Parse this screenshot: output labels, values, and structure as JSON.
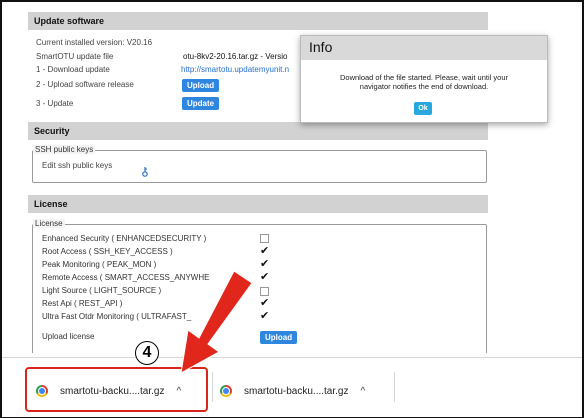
{
  "update": {
    "header": "Update software",
    "current_version": "Current installed version: V20.16",
    "file_label": "SmartOTU update file",
    "file_value": "otu-8kv2-20.16.tar.gz - Versio",
    "step1": "1 - Download update",
    "step1_link": "http://smartotu.updatemyunit.n",
    "step2": "2 - Upload software release",
    "step2_button": "Upload",
    "step3": "3 - Update",
    "step3_button": "Update"
  },
  "security": {
    "header": "Security",
    "ssh_legend": "SSH public keys",
    "ssh_edit": "Edit ssh public keys"
  },
  "license": {
    "header": "License",
    "legend": "License",
    "items": [
      {
        "label": "Enhanced Security ( ENHANCEDSECURITY )",
        "checked": false
      },
      {
        "label": "Root Access ( SSH_KEY_ACCESS )",
        "checked": true
      },
      {
        "label": "Peak Monitoring ( PEAK_MON )",
        "checked": true
      },
      {
        "label": "Remote Access ( SMART_ACCESS_ANYWHE",
        "checked": true
      },
      {
        "label": "Light Source ( LIGHT_SOURCE )",
        "checked": false
      },
      {
        "label": "Rest Api ( REST_API )",
        "checked": true
      },
      {
        "label": "Ultra Fast Otdr Monitoring ( ULTRAFAST_",
        "checked": true
      }
    ],
    "upload_label": "Upload license",
    "upload_button": "Upload"
  },
  "modal": {
    "title": "Info",
    "message_line1": "Download of the file started. Please, wait until your",
    "message_line2": "navigator notifies the end of download.",
    "ok": "Ok"
  },
  "downloads": [
    {
      "name": "smartotu-backu....tar.gz",
      "chevron": "^",
      "icon": "chrome-icon"
    },
    {
      "name": "smartotu-backu....tar.gz",
      "chevron": "^",
      "icon": "chrome-icon"
    }
  ],
  "annotation": {
    "step_number": "4",
    "arrow_color": "#e1271b",
    "highlight_color": "#d9261c"
  },
  "colors": {
    "button_blue": "#2e86de",
    "ok_blue": "#29a8e0",
    "link_blue": "#2a6fc9",
    "section_gray": "#d2d2d2"
  }
}
